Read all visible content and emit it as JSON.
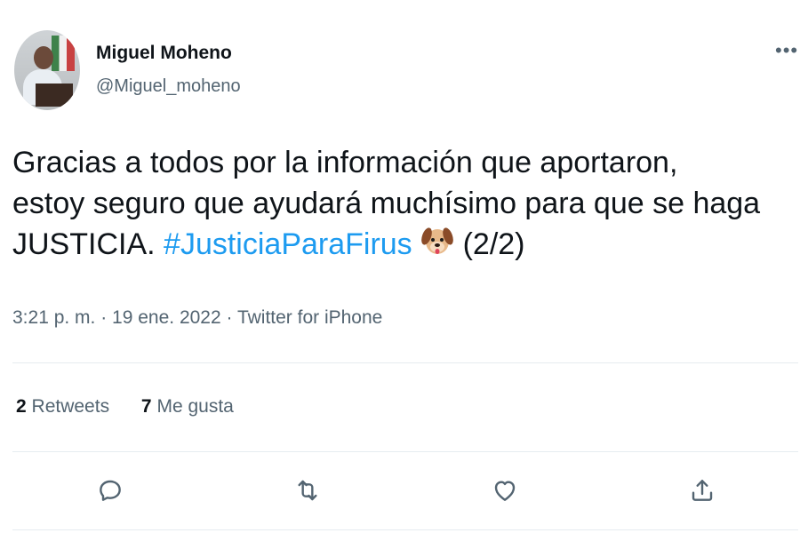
{
  "author": {
    "name": "Miguel Moheno",
    "handle": "@Miguel_moheno"
  },
  "tweet": {
    "line1": "Gracias a todos por la información que aportaron,",
    "line2": "estoy seguro que ayudará muchísimo para que se haga",
    "line3_start": "JUSTICIA. ",
    "hashtag": "#JusticiaParaFirus",
    "line3_end": "(2/2)",
    "emoji": "dog-face-emoji"
  },
  "meta": "3:21 p. m. · 19 ene. 2022 · Twitter for iPhone",
  "stats": {
    "retweets_count": "2",
    "retweets_label": "Retweets",
    "likes_count": "7",
    "likes_label": "Me gusta"
  },
  "icons": {
    "more": "more-icon",
    "reply": "reply-icon",
    "retweet": "retweet-icon",
    "like": "like-icon",
    "share": "share-icon"
  },
  "colors": {
    "text": "#0f1419",
    "secondary": "#536471",
    "hashtag": "#1d9bf0",
    "divider": "#e6ecf0"
  }
}
